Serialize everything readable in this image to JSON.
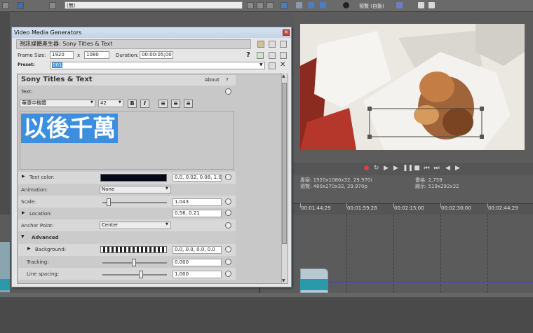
{
  "editor": {
    "top_combo_value": "(無)",
    "preview_mode": "預覽 (自動)",
    "project_info": "專案: 1920x1080x32, 29.970i",
    "preview_info": "預覽: 480x270x32, 29.970p",
    "frame_info": "畫格: 2,759",
    "display_info": "顯示: 519x292x32",
    "timecodes": [
      "00:01:44;29",
      "00:01:59;28",
      "00:02:15;00",
      "00:02:30;00",
      "00:02:44;29"
    ]
  },
  "dialog": {
    "title": "Video Media Generators",
    "generator_tab": "視訊媒體產生器: Sony Titles & Text",
    "frame_size_label": "Frame Size:",
    "frame_width": "1920",
    "x_label": "x",
    "frame_height": "1080",
    "duration_label": "Duration:",
    "duration_value": "00:00:05;00",
    "preset_label": "Preset:",
    "preset_value": "001",
    "plugin_title": "Sony Titles & Text",
    "about_label": "About",
    "help_label": "?",
    "text_label": "Text:",
    "font_name": "華康中楷體",
    "font_size": "42",
    "bold_label": "B",
    "italic_label": "I",
    "text_content": "以後千萬",
    "text_color_label": "Text color:",
    "text_color_value": "0.0, 0.02, 0.08, 1.0",
    "text_color_swatch": "#040818",
    "animation_label": "Animation:",
    "animation_value": "None",
    "scale_label": "Scale:",
    "scale_value": "1.043",
    "location_label": "Location:",
    "location_value": "0.56, 0.21",
    "anchor_label": "Anchor Point:",
    "anchor_value": "Center",
    "advanced_label": "Advanced",
    "background_label": "Background:",
    "background_value": "0.0, 0.0, 0.0, 0.0",
    "tracking_label": "Tracking:",
    "tracking_value": "0.000",
    "line_spacing_label": "Line spacing:",
    "line_spacing_value": "1.000"
  },
  "colors": {
    "selection_blue": "#3c8fe0",
    "dialog_bg": "#e6e6e6",
    "record_red": "#d02020"
  }
}
